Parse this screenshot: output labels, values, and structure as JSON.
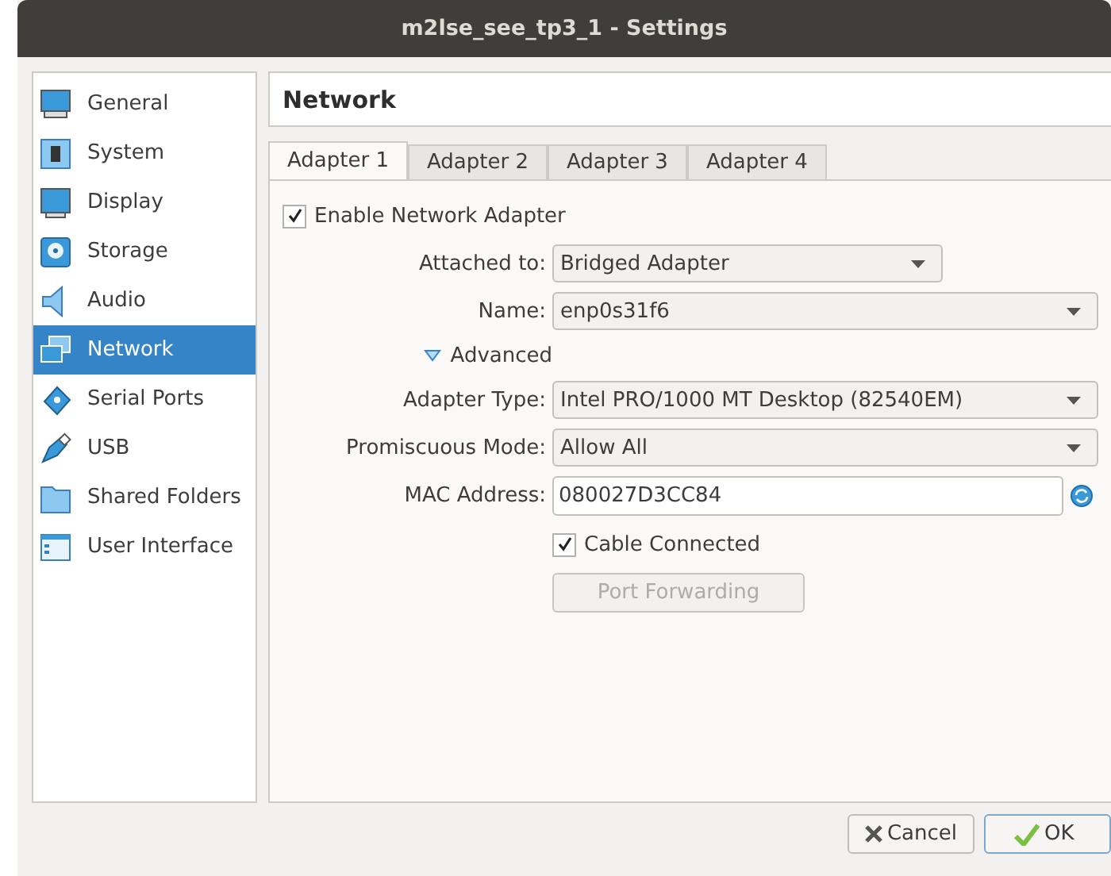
{
  "window": {
    "title": "m2lse_see_tp3_1 - Settings"
  },
  "sidebar": {
    "items": [
      {
        "label": "General",
        "selected": false
      },
      {
        "label": "System",
        "selected": false
      },
      {
        "label": "Display",
        "selected": false
      },
      {
        "label": "Storage",
        "selected": false
      },
      {
        "label": "Audio",
        "selected": false
      },
      {
        "label": "Network",
        "selected": true
      },
      {
        "label": "Serial Ports",
        "selected": false
      },
      {
        "label": "USB",
        "selected": false
      },
      {
        "label": "Shared Folders",
        "selected": false
      },
      {
        "label": "User Interface",
        "selected": false
      }
    ]
  },
  "page_title": "Network",
  "tabs": [
    {
      "label": "Adapter 1",
      "selected": true
    },
    {
      "label": "Adapter 2",
      "selected": false
    },
    {
      "label": "Adapter 3",
      "selected": false
    },
    {
      "label": "Adapter 4",
      "selected": false
    }
  ],
  "form": [
    {
      "kind": "checkbox",
      "label": "Enable Network Adapter",
      "checked": true
    },
    {
      "kind": "combo",
      "label": "Attached to:",
      "value": "Bridged Adapter",
      "wide": false
    },
    {
      "kind": "combo",
      "label": "Name:",
      "value": "enp0s31f6",
      "wide": true
    },
    {
      "kind": "expander",
      "label": "Advanced",
      "expanded": true
    },
    {
      "kind": "combo",
      "label": "Adapter Type:",
      "value": "Intel PRO/1000 MT Desktop (82540EM)",
      "wide": true
    },
    {
      "kind": "combo",
      "label": "Promiscuous Mode:",
      "value": "Allow All",
      "wide": true
    },
    {
      "kind": "text",
      "label": "MAC Address:",
      "value": "080027D3CC84"
    },
    {
      "kind": "checkbox",
      "label": "Cable Connected",
      "checked": true
    },
    {
      "kind": "button",
      "label": "Port Forwarding",
      "disabled": true
    }
  ],
  "buttons": [
    {
      "kind": "cancel",
      "label": "Cancel"
    },
    {
      "kind": "ok",
      "label": "OK"
    }
  ]
}
